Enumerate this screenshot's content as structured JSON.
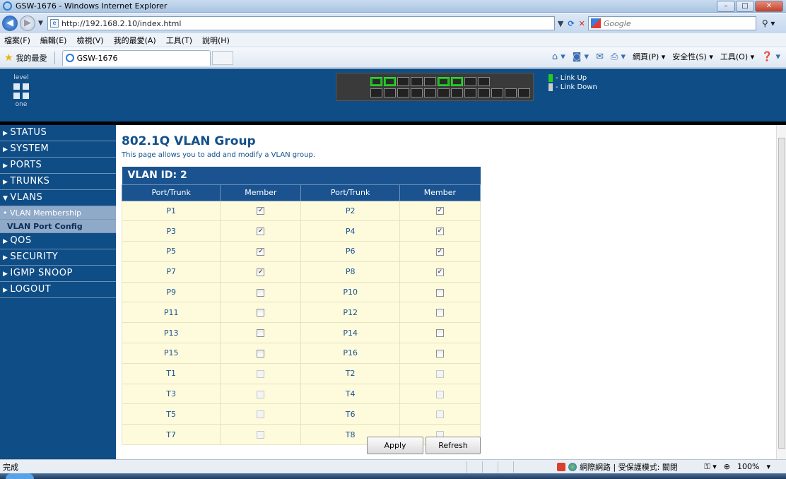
{
  "window": {
    "title": "GSW-1676 - Windows Internet Explorer",
    "min": "–",
    "max": "□",
    "close": "✕"
  },
  "address": {
    "url": "http://192.168.2.10/index.html",
    "search_placeholder": "Google"
  },
  "menu": [
    "檔案(F)",
    "編輯(E)",
    "檢視(V)",
    "我的最愛(A)",
    "工具(T)",
    "說明(H)"
  ],
  "favorites": {
    "label": "我的最愛",
    "tab_title": "GSW-1676"
  },
  "commands": [
    "網頁(P) ▾",
    "安全性(S) ▾",
    "工具(O) ▾"
  ],
  "device": {
    "logo_top": "level",
    "logo_bottom": "one",
    "legend_up": "- Link Up",
    "legend_down": "- Link Down",
    "legend_up_color": "#22cc22",
    "legend_down_color": "#cccccc"
  },
  "sidebar": {
    "status": "STATUS",
    "system": "SYSTEM",
    "ports": "PORTS",
    "trunks": "TRUNKS",
    "vlans": "VLANS",
    "vlan_membership": "• VLAN Membership",
    "vlan_port_config": "VLAN Port Config",
    "qos": "QOS",
    "security": "SECURITY",
    "igmp": "IGMP SNOOP",
    "logout": "LOGOUT"
  },
  "page": {
    "title": "802.1Q VLAN Group",
    "description": "This page allows you to add and modify a VLAN group.",
    "vlan_id_label": "VLAN ID: 2",
    "col_port": "Port/Trunk",
    "col_member": "Member"
  },
  "rows": [
    {
      "left": "P1",
      "left_checked": true,
      "right": "P2",
      "right_checked": true,
      "disabled": false
    },
    {
      "left": "P3",
      "left_checked": true,
      "right": "P4",
      "right_checked": true,
      "disabled": false
    },
    {
      "left": "P5",
      "left_checked": true,
      "right": "P6",
      "right_checked": true,
      "disabled": false
    },
    {
      "left": "P7",
      "left_checked": true,
      "right": "P8",
      "right_checked": true,
      "disabled": false
    },
    {
      "left": "P9",
      "left_checked": false,
      "right": "P10",
      "right_checked": false,
      "disabled": false
    },
    {
      "left": "P11",
      "left_checked": false,
      "right": "P12",
      "right_checked": false,
      "disabled": false
    },
    {
      "left": "P13",
      "left_checked": false,
      "right": "P14",
      "right_checked": false,
      "disabled": false
    },
    {
      "left": "P15",
      "left_checked": false,
      "right": "P16",
      "right_checked": false,
      "disabled": false
    },
    {
      "left": "T1",
      "left_checked": false,
      "right": "T2",
      "right_checked": false,
      "disabled": true
    },
    {
      "left": "T3",
      "left_checked": false,
      "right": "T4",
      "right_checked": false,
      "disabled": true
    },
    {
      "left": "T5",
      "left_checked": false,
      "right": "T6",
      "right_checked": false,
      "disabled": true
    },
    {
      "left": "T7",
      "left_checked": false,
      "right": "T8",
      "right_checked": false,
      "disabled": true
    }
  ],
  "buttons": {
    "apply": "Apply",
    "refresh": "Refresh"
  },
  "statusbar": {
    "text": "完成",
    "zone": "網際網路 | 受保護模式: 關閉",
    "zoom": "100%"
  }
}
